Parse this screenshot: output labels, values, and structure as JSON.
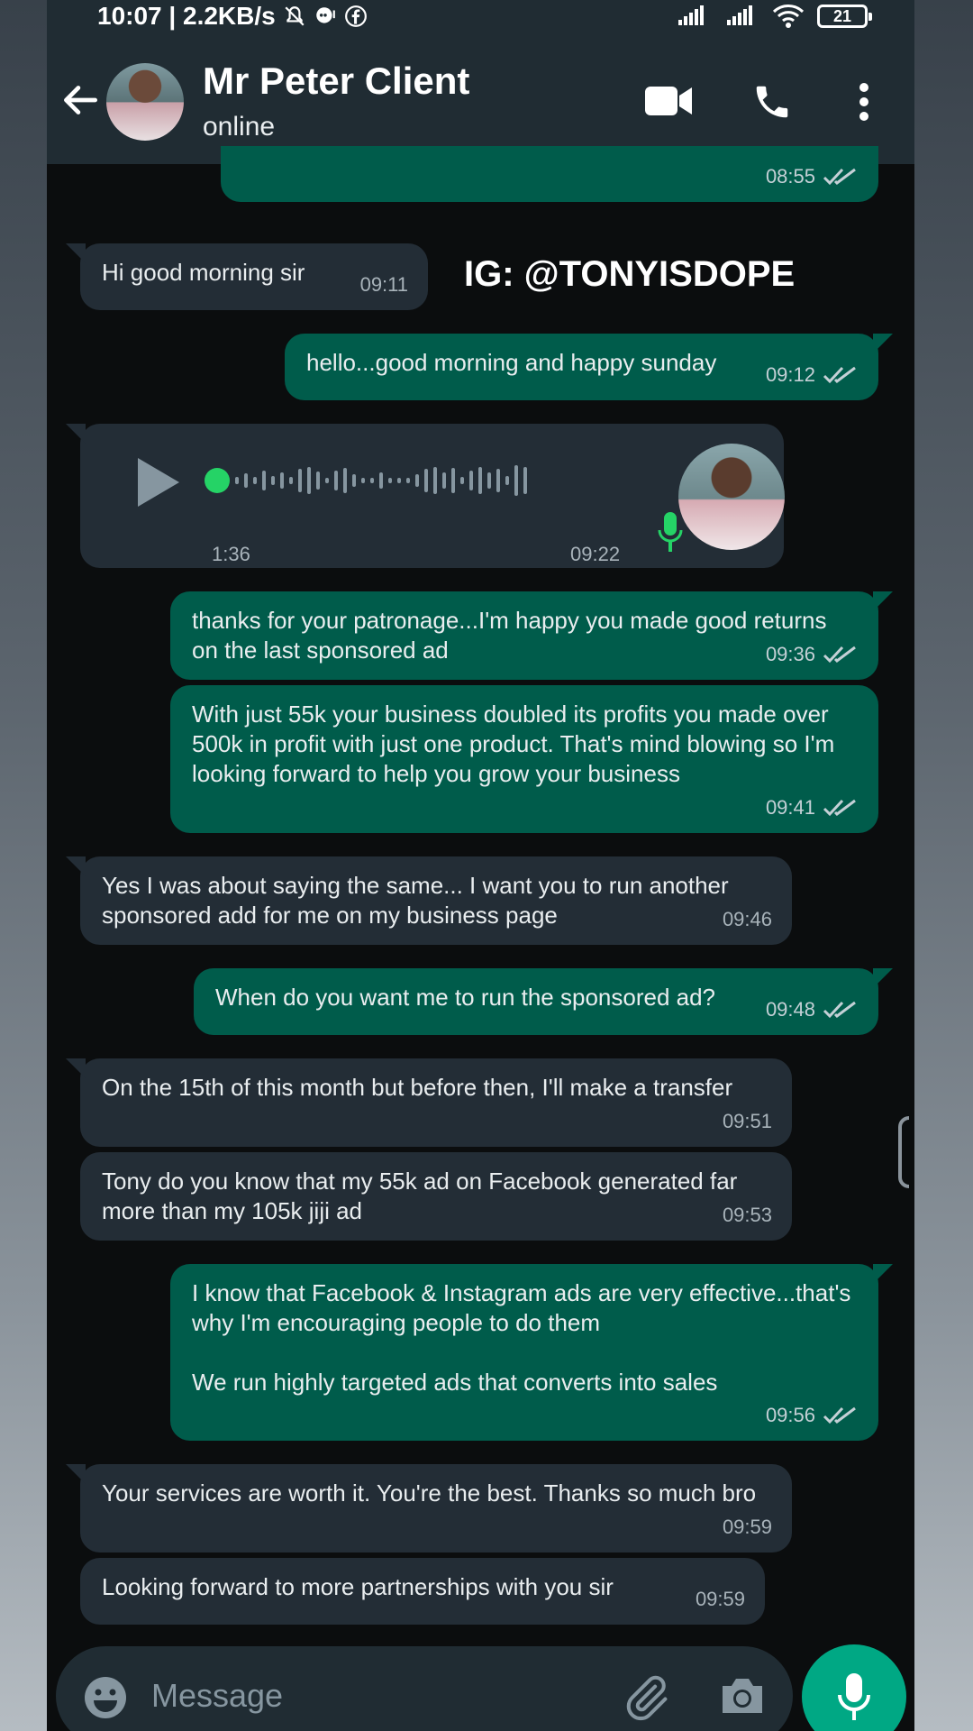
{
  "status_bar": {
    "time_speed": "10:07 | 2.2KB/s",
    "battery": "21"
  },
  "header": {
    "contact_name": "Mr Peter Client",
    "contact_status": "online"
  },
  "watermark": "IG: @TONYISDOPE",
  "messages": [
    {
      "id": "m0",
      "dir": "out",
      "text": "",
      "time": "08:55"
    },
    {
      "id": "m1",
      "dir": "in",
      "text": "Hi good morning sir",
      "time": "09:11"
    },
    {
      "id": "m2",
      "dir": "out",
      "text": "hello...good morning and happy sunday",
      "time": "09:12"
    },
    {
      "id": "m3",
      "dir": "in",
      "type": "voice",
      "duration": "1:36",
      "time": "09:22"
    },
    {
      "id": "m4",
      "dir": "out",
      "text": "thanks for your patronage...I'm happy you made good returns on the last sponsored ad",
      "time": "09:36"
    },
    {
      "id": "m5",
      "dir": "out",
      "text": "With just 55k your business doubled its profits you made over 500k in profit with just one product. That's mind blowing so I'm looking forward to help you grow your business",
      "time": "09:41"
    },
    {
      "id": "m6",
      "dir": "in",
      "text": "Yes I was about saying the same... I want you to run another sponsored add for me on my business page",
      "time": "09:46"
    },
    {
      "id": "m7",
      "dir": "out",
      "text": "When do you want me to run the sponsored ad?",
      "time": "09:48"
    },
    {
      "id": "m8",
      "dir": "in",
      "text": "On the 15th of this month but before then, I'll make a transfer",
      "time": "09:51"
    },
    {
      "id": "m9",
      "dir": "in",
      "text": "Tony do you know that my 55k ad on Facebook generated far more than my 105k jiji ad",
      "time": "09:53"
    },
    {
      "id": "m10",
      "dir": "out",
      "text": "I know that Facebook & Instagram ads are very effective...that's why I'm encouraging people to do them\n\nWe run highly targeted ads that converts into sales",
      "time": "09:56"
    },
    {
      "id": "m11",
      "dir": "in",
      "text": "Your services are worth it. You're the best. Thanks so much bro",
      "time": "09:59"
    },
    {
      "id": "m12",
      "dir": "in",
      "text": "Looking forward to more partnerships with you sir",
      "time": "09:59"
    }
  ],
  "input": {
    "placeholder": "Message"
  },
  "colors": {
    "incoming_bubble": "#232d36",
    "outgoing_bubble": "#005c4b",
    "accent": "#00a884",
    "header": "#202c33"
  }
}
